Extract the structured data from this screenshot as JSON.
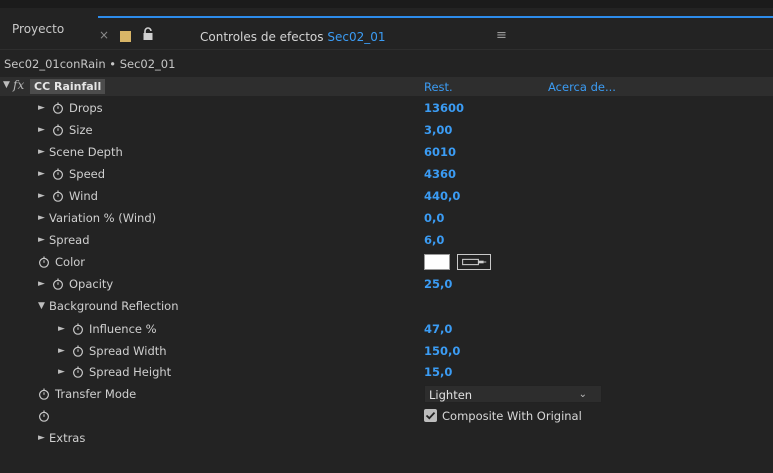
{
  "tabs": {
    "project": "Proyecto",
    "close": "×",
    "effects_prefix": "Controles de efectos ",
    "effects_comp": "Sec02_01",
    "menu": "≡"
  },
  "breadcrumb": "Sec02_01conRain • Sec02_01",
  "effect": {
    "fx": "fx",
    "name": "CC Rainfall",
    "reset": "Rest.",
    "about": "Acerca de..."
  },
  "params": {
    "drops": {
      "label": "Drops",
      "value": "13600"
    },
    "size": {
      "label": "Size",
      "value": "3,00"
    },
    "scene_depth": {
      "label": "Scene Depth",
      "value": "6010"
    },
    "speed": {
      "label": "Speed",
      "value": "4360"
    },
    "wind": {
      "label": "Wind",
      "value": "440,0"
    },
    "variation": {
      "label": "Variation % (Wind)",
      "value": "0,0"
    },
    "spread": {
      "label": "Spread",
      "value": "6,0"
    },
    "color": {
      "label": "Color",
      "value": "#ffffff"
    },
    "opacity": {
      "label": "Opacity",
      "value": "25,0"
    },
    "bg_reflection": {
      "label": "Background Reflection"
    },
    "influence": {
      "label": "Influence %",
      "value": "47,0"
    },
    "spread_width": {
      "label": "Spread Width",
      "value": "150,0"
    },
    "spread_height": {
      "label": "Spread Height",
      "value": "15,0"
    },
    "transfer_mode": {
      "label": "Transfer Mode",
      "value": "Lighten"
    },
    "composite": {
      "label": "Composite With Original",
      "checked": true
    },
    "extras": {
      "label": "Extras"
    }
  },
  "colors": {
    "accent": "#2d8ceb",
    "value_blue": "#3b9cf4",
    "background": "#232323"
  }
}
